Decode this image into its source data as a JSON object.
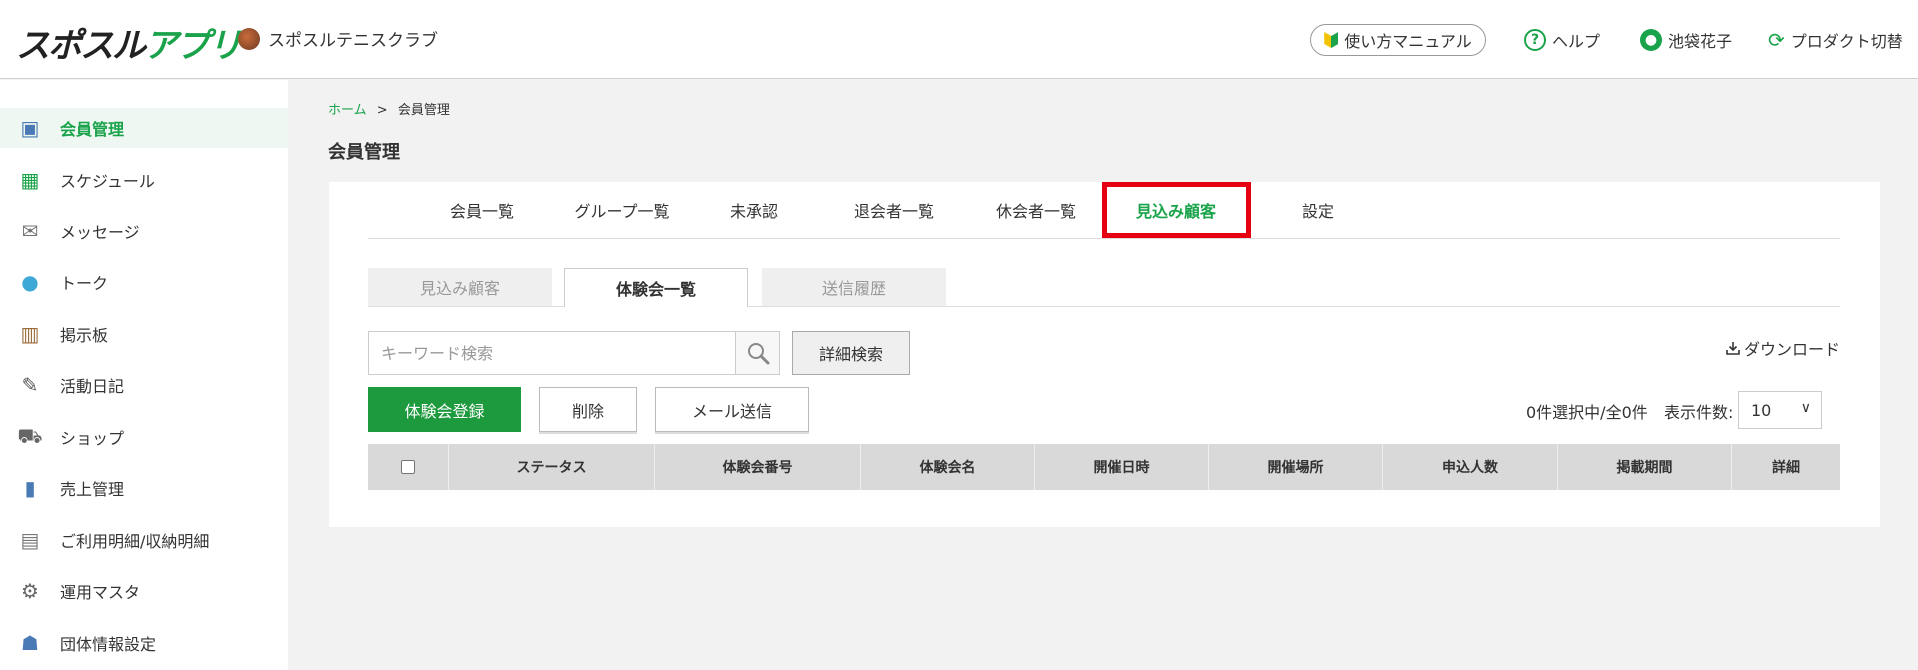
{
  "header": {
    "logo": {
      "text_black": "スポスル",
      "text_green": "アプリ"
    },
    "club_name": "スポスルテニスクラブ",
    "manual_label": "使い方マニュアル",
    "help_label": "ヘルプ",
    "user_name": "池袋花子",
    "product_switch_label": "プロダクト切替"
  },
  "sidebar": {
    "items": [
      {
        "label": "会員管理",
        "icon": "member-icon",
        "active": true
      },
      {
        "label": "スケジュール",
        "icon": "calendar-icon",
        "active": false
      },
      {
        "label": "メッセージ",
        "icon": "envelope-icon",
        "active": false
      },
      {
        "label": "トーク",
        "icon": "chat-bubble-icon",
        "active": false
      },
      {
        "label": "掲示板",
        "icon": "board-icon",
        "active": false
      },
      {
        "label": "活動日記",
        "icon": "diary-icon",
        "active": false
      },
      {
        "label": "ショップ",
        "icon": "cart-icon",
        "active": false
      },
      {
        "label": "売上管理",
        "icon": "sales-chart-icon",
        "active": false
      },
      {
        "label": "ご利用明細/収納明細",
        "icon": "receipt-icon",
        "active": false
      },
      {
        "label": "運用マスタ",
        "icon": "tools-icon",
        "active": false
      },
      {
        "label": "団体情報設定",
        "icon": "group-icon",
        "active": false
      }
    ]
  },
  "breadcrumb": {
    "home": "ホーム",
    "separator": ">",
    "current": "会員管理"
  },
  "page_title": "会員管理",
  "tabs": [
    {
      "label": "会員一覧"
    },
    {
      "label": "グループ一覧"
    },
    {
      "label": "未承認"
    },
    {
      "label": "退会者一覧"
    },
    {
      "label": "休会者一覧"
    },
    {
      "label": "見込み顧客",
      "active": true
    },
    {
      "label": "設定"
    }
  ],
  "subtabs": [
    {
      "label": "見込み顧客"
    },
    {
      "label": "体験会一覧",
      "active": true
    },
    {
      "label": "送信履歴"
    }
  ],
  "search": {
    "placeholder": "キーワード検索",
    "detail_label": "詳細検索"
  },
  "download_label": "ダウンロード",
  "actions": {
    "register": "体験会登録",
    "delete": "削除",
    "send_mail": "メール送信"
  },
  "selection_count": "0件選択中/全0件",
  "per_page": {
    "label": "表示件数:",
    "value": "10"
  },
  "table": {
    "columns": [
      "ステータス",
      "体験会番号",
      "体験会名",
      "開催日時",
      "開催場所",
      "申込人数",
      "掲載期間",
      "詳細"
    ]
  },
  "colors": {
    "accent": "#1aa34a",
    "primary_button": "#1e9a3e",
    "highlight": "#e60012"
  }
}
